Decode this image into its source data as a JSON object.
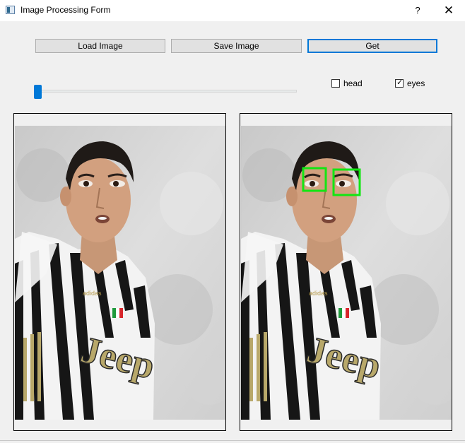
{
  "window": {
    "title": "Image Processing Form",
    "help_glyph": "?",
    "close_glyph": "✕"
  },
  "toolbar": {
    "load_label": "Load Image",
    "save_label": "Save Image",
    "get_label": "Get"
  },
  "controls": {
    "slider_value_fraction": 0.0,
    "head": {
      "label": "head",
      "checked": false
    },
    "eyes": {
      "label": "eyes",
      "checked": true,
      "check_glyph": "✓"
    }
  },
  "images": {
    "left": {
      "description_icon": "photo-original"
    },
    "right": {
      "description_icon": "photo-eyes-detected",
      "detection_color": "#12e612"
    }
  },
  "colors": {
    "accent": "#0078d7",
    "detection": "#12e612"
  }
}
